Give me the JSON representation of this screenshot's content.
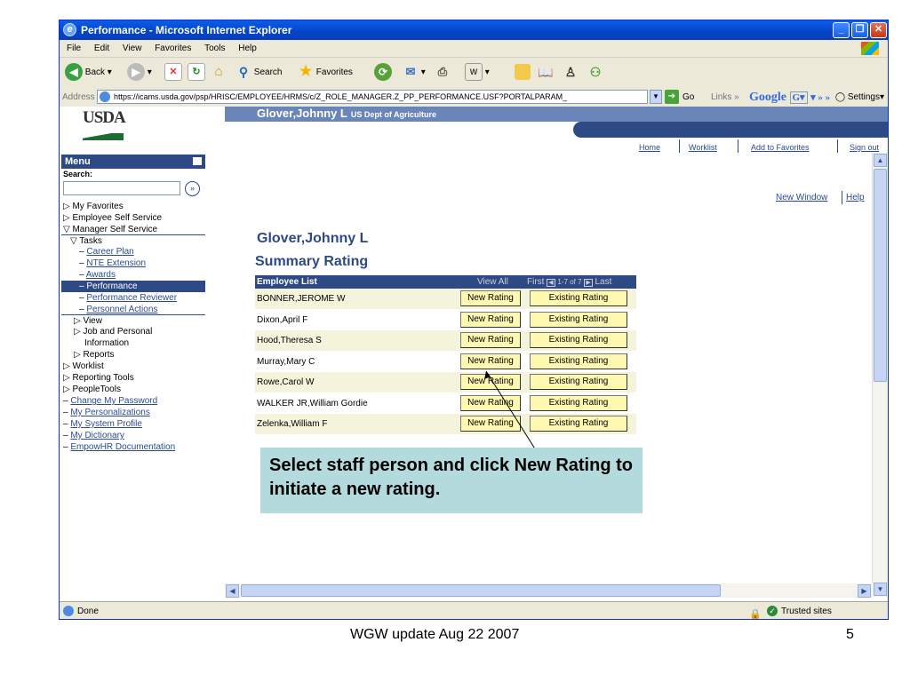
{
  "window": {
    "title": "Performance - Microsoft Internet Explorer"
  },
  "menubar": [
    "File",
    "Edit",
    "View",
    "Favorites",
    "Tools",
    "Help"
  ],
  "toolbar": {
    "back": "Back",
    "search": "Search",
    "favorites": "Favorites"
  },
  "address": {
    "label": "Address",
    "url": "https://icams.usda.gov/psp/HRISC/EMPLOYEE/HRMS/c/Z_ROLE_MANAGER.Z_PP_PERFORMANCE.USF?PORTALPARAM_",
    "go": "Go",
    "links": "Links",
    "google": "Google",
    "settings": "Settings"
  },
  "header": {
    "logo": "USDA",
    "user": "Glover,Johnny L",
    "agency": "US Dept of Agriculture",
    "nav": [
      "Home",
      "Worklist",
      "Add to Favorites",
      "Sign out"
    ]
  },
  "menu": {
    "title": "Menu",
    "search_label": "Search:",
    "items": [
      {
        "label": "My Favorites",
        "prefix": "▷ "
      },
      {
        "label": "Employee Self Service",
        "prefix": "▷ "
      },
      {
        "label": "Manager Self Service",
        "prefix": "▽ "
      },
      {
        "label": "Tasks",
        "prefix": "▽ "
      },
      {
        "label": "Career Plan",
        "prefix": "– "
      },
      {
        "label": "NTE Extension",
        "prefix": "– "
      },
      {
        "label": "Awards",
        "prefix": "– "
      },
      {
        "label": "Performance",
        "prefix": "– "
      },
      {
        "label": "Performance Reviewer",
        "prefix": "– "
      },
      {
        "label": "Personnel Actions",
        "prefix": "– "
      },
      {
        "label": "View",
        "prefix": "▷ "
      },
      {
        "label": "Job and Personal",
        "prefix": "▷ "
      },
      {
        "label": "Information",
        "prefix": ""
      },
      {
        "label": "Reports",
        "prefix": "▷ "
      },
      {
        "label": "Worklist",
        "prefix": "▷ "
      },
      {
        "label": "Reporting Tools",
        "prefix": "▷ "
      },
      {
        "label": "PeopleTools",
        "prefix": "▷ "
      },
      {
        "label": "Change My Password",
        "prefix": "– "
      },
      {
        "label": "My Personalizations",
        "prefix": "– "
      },
      {
        "label": "My System Profile",
        "prefix": "– "
      },
      {
        "label": "My Dictionary",
        "prefix": "– "
      },
      {
        "label": "EmpowHR Documentation",
        "prefix": "– "
      }
    ]
  },
  "page": {
    "new_window": "New Window",
    "help": "Help",
    "name": "Glover,Johnny L",
    "title": "Summary Rating",
    "grid": {
      "title": "Employee List",
      "view_all": "View All",
      "first": "First",
      "range": "1-7 of 7",
      "last": "Last",
      "new_label": "New Rating",
      "existing_label": "Existing Rating",
      "rows": [
        "BONNER,JEROME W",
        "Dixon,April F",
        "Hood,Theresa S",
        "Murray,Mary C",
        "Rowe,Carol W",
        "WALKER JR,William Gordie",
        "Zelenka,William F"
      ]
    }
  },
  "callout": "Select staff person and click New Rating to initiate a new rating.",
  "status": {
    "left": "Done",
    "zone": "Trusted sites"
  },
  "footer": {
    "caption": "WGW update Aug 22 2007",
    "page": "5"
  }
}
